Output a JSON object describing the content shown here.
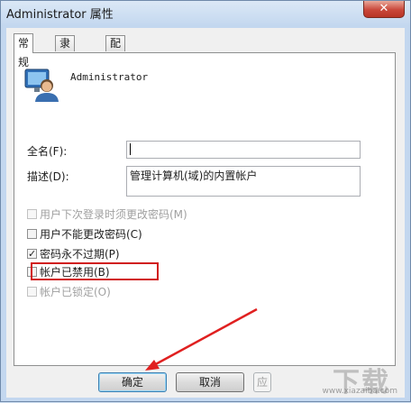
{
  "window": {
    "title": "Administrator 属性",
    "close_glyph": "✕"
  },
  "tabs": [
    {
      "label": "常规",
      "active": true
    },
    {
      "label": "隶属于",
      "active": false
    },
    {
      "label": "配置文件",
      "active": false
    }
  ],
  "general": {
    "account_name": "Administrator",
    "full_name_label": "全名(F):",
    "full_name_value": "",
    "description_label": "描述(D):",
    "description_value": "管理计算机(域)的内置帐户"
  },
  "checkboxes": [
    {
      "label": "用户下次登录时须更改密码(M)",
      "checked": false,
      "enabled": false
    },
    {
      "label": "用户不能更改密码(C)",
      "checked": false,
      "enabled": true
    },
    {
      "label": "密码永不过期(P)",
      "checked": true,
      "enabled": true
    },
    {
      "label": "帐户已禁用(B)",
      "checked": false,
      "enabled": true
    },
    {
      "label": "帐户已锁定(O)",
      "checked": false,
      "enabled": false
    }
  ],
  "buttons": {
    "ok": "确定",
    "cancel": "取消",
    "apply": "应"
  },
  "watermark": {
    "mark": "下载",
    "url": "www.xiazaiba.com"
  },
  "colors": {
    "highlight": "#d11a1a",
    "arrow": "#e02020"
  }
}
